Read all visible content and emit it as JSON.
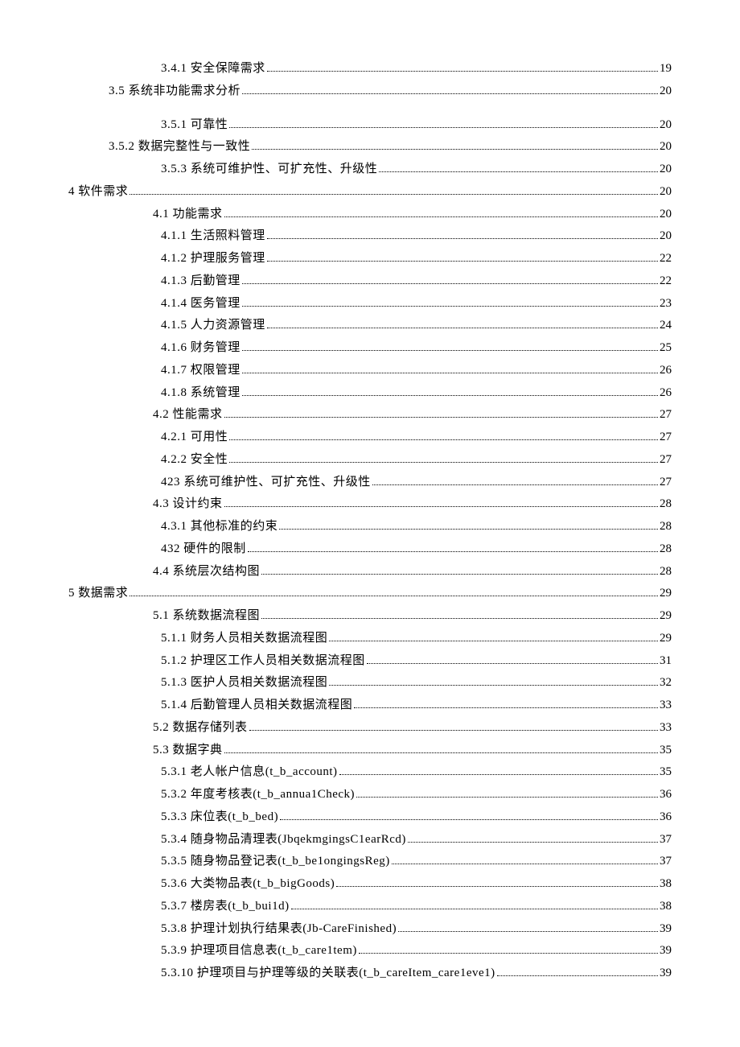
{
  "toc": [
    {
      "indent": 3,
      "num": "3.4.1",
      "title": "安全保障需求",
      "page": "19",
      "gap": false
    },
    {
      "indent": 1,
      "num": "3.5",
      "title": " 系统非功能需求分析",
      "page": "20",
      "gap": false
    },
    {
      "indent": 3,
      "num": "3.5.1",
      "title": "可靠性",
      "page": "20",
      "gap": true
    },
    {
      "indent": 1,
      "num": "3.5.2",
      "title": " 数据完整性与一致性",
      "page": "20",
      "gap": false
    },
    {
      "indent": 3,
      "num": "3.5.3",
      "title": " 系统可维护性、可扩充性、升级性",
      "page": "20",
      "gap": false
    },
    {
      "indent": 0,
      "num": "4",
      "title": " 软件需求",
      "page": "20",
      "gap": false
    },
    {
      "indent": 2,
      "num": "4.1",
      "title": "  功能需求",
      "page": "20",
      "gap": false
    },
    {
      "indent": 3,
      "num": "4.1.1",
      "title": "生活照料管理",
      "page": "20",
      "gap": false
    },
    {
      "indent": 3,
      "num": "4.1.2",
      "title": " 护理服务管理",
      "page": "22",
      "gap": false
    },
    {
      "indent": 3,
      "num": "4.1.3",
      "title": " 后勤管理",
      "page": "22",
      "gap": false
    },
    {
      "indent": 3,
      "num": "4.1.4",
      "title": " 医务管理",
      "page": "23",
      "gap": false
    },
    {
      "indent": 3,
      "num": "4.1.5",
      "title": " 人力资源管理",
      "page": "24",
      "gap": false
    },
    {
      "indent": 3,
      "num": "4.1.6",
      "title": " 财务管理",
      "page": "25",
      "gap": false
    },
    {
      "indent": 3,
      "num": "4.1.7",
      "title": " 权限管理",
      "page": "26",
      "gap": false
    },
    {
      "indent": 3,
      "num": "4.1.8",
      "title": " 系统管理",
      "page": "26",
      "gap": false
    },
    {
      "indent": 2,
      "num": "4.2",
      "title": "  性能需求",
      "page": "27",
      "gap": false
    },
    {
      "indent": 3,
      "num": "4.2.1",
      "title": " 可用性",
      "page": "27",
      "gap": false
    },
    {
      "indent": 3,
      "num": "4.2.2",
      "title": " 安全性",
      "page": "27",
      "gap": false
    },
    {
      "indent": 3,
      "num": "423",
      "title": " 系统可维护性、可扩充性、升级性",
      "page": "27",
      "gap": false
    },
    {
      "indent": 2,
      "num": "4.3",
      "title": "  设计约束",
      "page": "28",
      "gap": false
    },
    {
      "indent": 3,
      "num": "4.3.1",
      "title": " 其他标准的约束",
      "page": "28",
      "gap": false
    },
    {
      "indent": 3,
      "num": "432",
      "title": " 硬件的限制",
      "page": "28",
      "gap": false
    },
    {
      "indent": 2,
      "num": "4.4",
      "title": "  系统层次结构图",
      "page": "28",
      "gap": false
    },
    {
      "indent": 0,
      "num": "5",
      "title": " 数据需求",
      "page": "29",
      "gap": false
    },
    {
      "indent": 2,
      "num": "5.1",
      "title": "  系统数据流程图",
      "page": "29",
      "gap": false
    },
    {
      "indent": 3,
      "num": "5.1.1",
      "title": "财务人员相关数据流程图",
      "page": "29",
      "gap": false
    },
    {
      "indent": 3,
      "num": "5.1.2",
      "title": " 护理区工作人员相关数据流程图",
      "page": "31",
      "gap": false
    },
    {
      "indent": 3,
      "num": "5.1.3",
      "title": " 医护人员相关数据流程图",
      "page": "32",
      "gap": false
    },
    {
      "indent": 3,
      "num": "5.1.4",
      "title": " 后勤管理人员相关数据流程图",
      "page": "33",
      "gap": false
    },
    {
      "indent": 2,
      "num": "5.2",
      "title": "  数据存储列表",
      "page": "33",
      "gap": false
    },
    {
      "indent": 2,
      "num": "5.3",
      "title": "  数据字典",
      "page": "35",
      "gap": false
    },
    {
      "indent": 3,
      "num": "5.3.1",
      "title": "老人帐户信息(t_b_account)",
      "page": "35",
      "gap": false
    },
    {
      "indent": 3,
      "num": "5.3.2",
      "title": " 年度考核表(t_b_annua1Check)",
      "page": "36",
      "gap": false
    },
    {
      "indent": 3,
      "num": "5.3.3",
      "title": " 床位表(t_b_bed)",
      "page": "36",
      "gap": false
    },
    {
      "indent": 3,
      "num": "5.3.4",
      "title": " 随身物品清理表(JbqekmgingsC1earRcd)",
      "page": "37",
      "gap": false
    },
    {
      "indent": 3,
      "num": "5.3.5",
      "title": " 随身物品登记表(t_b_be1ongingsReg)",
      "page": "37",
      "gap": false
    },
    {
      "indent": 3,
      "num": "5.3.6",
      "title": " 大类物品表(t_b_bigGoods)",
      "page": "38",
      "gap": false
    },
    {
      "indent": 3,
      "num": "5.3.7",
      "title": " 楼房表(t_b_bui1d)",
      "page": "38",
      "gap": false
    },
    {
      "indent": 3,
      "num": "5.3.8",
      "title": " 护理计划执行结果表(Jb-CareFinished)",
      "page": "39",
      "gap": false
    },
    {
      "indent": 3,
      "num": "5.3.9",
      "title": " 护理项目信息表(t_b_care1tem)",
      "page": "39",
      "gap": false
    },
    {
      "indent": 3,
      "num": "5.3.10",
      "title": " 护理项目与护理等级的关联表(t_b_careItem_care1eve1)",
      "page": "39",
      "gap": false
    }
  ]
}
